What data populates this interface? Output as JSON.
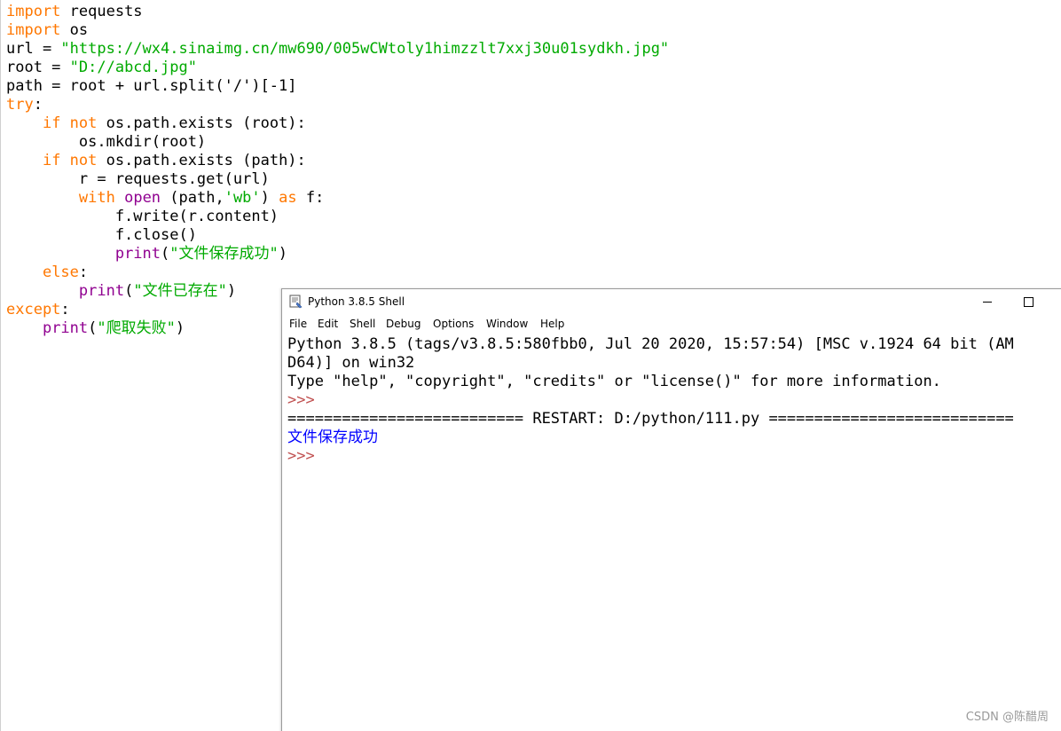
{
  "editor": {
    "lines": [
      [
        {
          "t": "import",
          "c": "kw"
        },
        {
          "t": " requests",
          "c": ""
        }
      ],
      [
        {
          "t": "import",
          "c": "kw"
        },
        {
          "t": " os",
          "c": ""
        }
      ],
      [
        {
          "t": "url = ",
          "c": ""
        },
        {
          "t": "\"https://wx4.sinaimg.cn/mw690/005wCWtoly1himzzlt7xxj30u01sydkh.jpg\"",
          "c": "str"
        }
      ],
      [
        {
          "t": "root = ",
          "c": ""
        },
        {
          "t": "\"D://abcd.jpg\"",
          "c": "str"
        }
      ],
      [
        {
          "t": "path = root + url.split('/')[-1]",
          "c": ""
        }
      ],
      [
        {
          "t": "try",
          "c": "kw"
        },
        {
          "t": ":",
          "c": ""
        }
      ],
      [
        {
          "t": "    ",
          "c": ""
        },
        {
          "t": "if not",
          "c": "kw"
        },
        {
          "t": " os.path.exists (root):",
          "c": ""
        }
      ],
      [
        {
          "t": "        os.mkdir(root)",
          "c": ""
        }
      ],
      [
        {
          "t": "    ",
          "c": ""
        },
        {
          "t": "if not",
          "c": "kw"
        },
        {
          "t": " os.path.exists (path):",
          "c": ""
        }
      ],
      [
        {
          "t": "        r = requests.get(url)",
          "c": ""
        }
      ],
      [
        {
          "t": "        ",
          "c": ""
        },
        {
          "t": "with",
          "c": "kw"
        },
        {
          "t": " ",
          "c": ""
        },
        {
          "t": "open",
          "c": "bi"
        },
        {
          "t": " (path,",
          "c": ""
        },
        {
          "t": "'wb'",
          "c": "str"
        },
        {
          "t": ") ",
          "c": ""
        },
        {
          "t": "as",
          "c": "kw"
        },
        {
          "t": " f:",
          "c": ""
        }
      ],
      [
        {
          "t": "            f.write(r.content)",
          "c": ""
        }
      ],
      [
        {
          "t": "            f.close()",
          "c": ""
        }
      ],
      [
        {
          "t": "            ",
          "c": ""
        },
        {
          "t": "print",
          "c": "bi"
        },
        {
          "t": "(",
          "c": ""
        },
        {
          "t": "\"文件保存成功\"",
          "c": "str"
        },
        {
          "t": ")",
          "c": ""
        }
      ],
      [
        {
          "t": "    ",
          "c": ""
        },
        {
          "t": "else",
          "c": "kw"
        },
        {
          "t": ":",
          "c": ""
        }
      ],
      [
        {
          "t": "        ",
          "c": ""
        },
        {
          "t": "print",
          "c": "bi"
        },
        {
          "t": "(",
          "c": ""
        },
        {
          "t": "\"文件已存在\"",
          "c": "str"
        },
        {
          "t": ")",
          "c": ""
        }
      ],
      [
        {
          "t": "except",
          "c": "kw"
        },
        {
          "t": ":",
          "c": ""
        }
      ],
      [
        {
          "t": "    ",
          "c": ""
        },
        {
          "t": "print",
          "c": "bi"
        },
        {
          "t": "(",
          "c": ""
        },
        {
          "t": "\"爬取失败\"",
          "c": "str"
        },
        {
          "t": ")",
          "c": ""
        }
      ]
    ]
  },
  "shell": {
    "title": "Python 3.8.5 Shell",
    "menu": [
      "File",
      "Edit",
      "Shell",
      "Debug",
      "Options",
      "Window",
      "Help"
    ],
    "lines": [
      {
        "text": "Python 3.8.5 (tags/v3.8.5:580fbb0, Jul 20 2020, 15:57:54) [MSC v.1924 64 bit (AM",
        "style": ""
      },
      {
        "text": "D64)] on win32",
        "style": ""
      },
      {
        "text": "Type \"help\", \"copyright\", \"credits\" or \"license()\" for more information.",
        "style": ""
      },
      {
        "text": ">>> ",
        "style": "prompt"
      },
      {
        "text": "========================== RESTART: D:/python/111.py ===========================",
        "style": ""
      },
      {
        "text": "文件保存成功",
        "style": "output-blue"
      },
      {
        "text": ">>> ",
        "style": "prompt"
      }
    ]
  },
  "watermark": "CSDN @陈醋周",
  "colors": {
    "keyword": "#ff7700",
    "string": "#00aa00",
    "builtin": "#900090",
    "prompt": "#c05050",
    "stdout": "#0000ff"
  }
}
